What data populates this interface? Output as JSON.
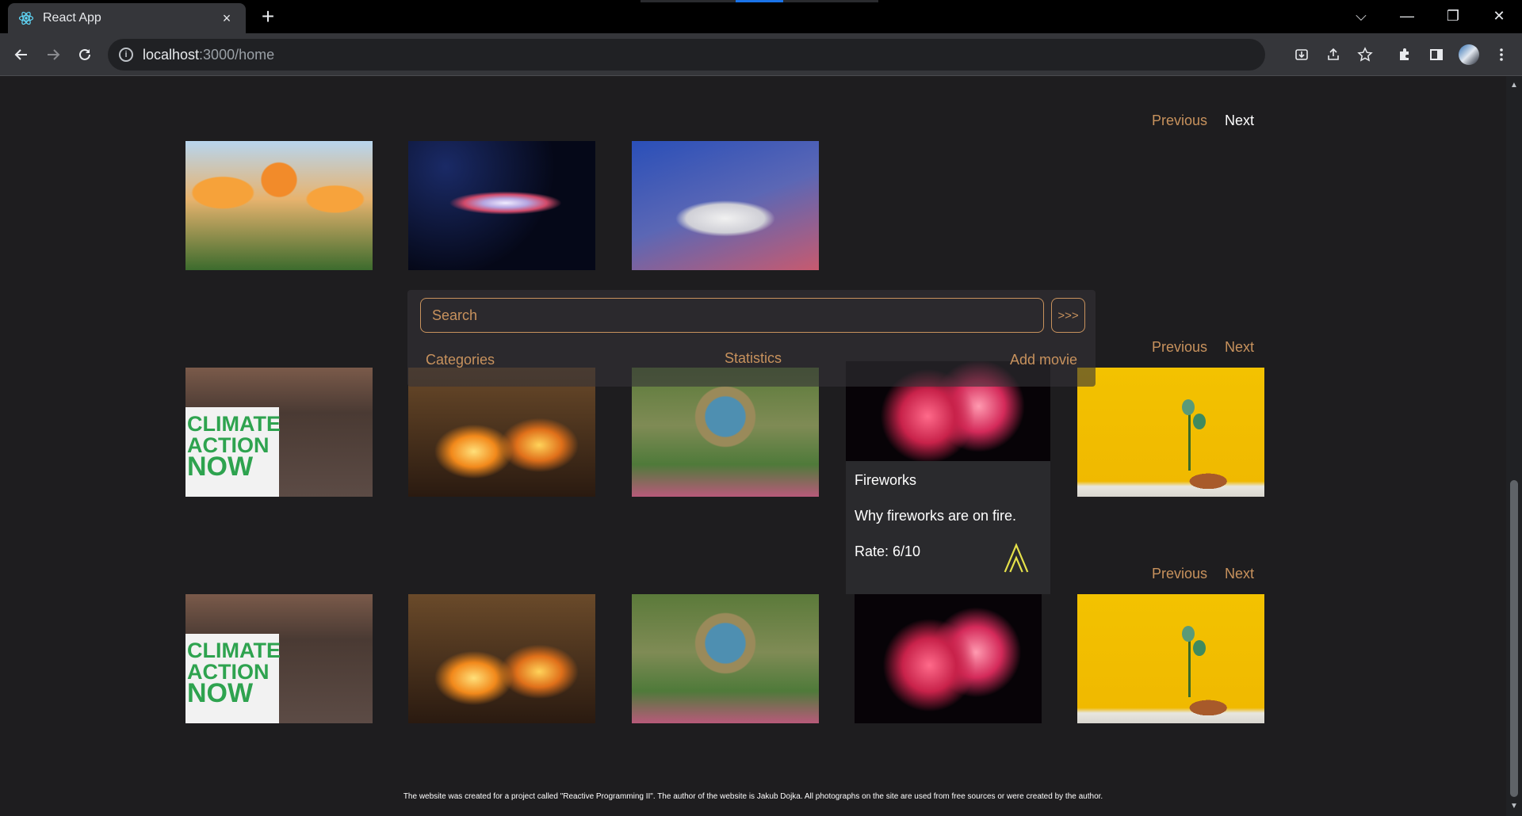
{
  "browser": {
    "tab_title": "React App",
    "tab_close": "×",
    "new_tab": "+",
    "url_host": "localhost",
    "url_path": ":3000/home",
    "window_controls": [
      "⌵",
      "—",
      "❐",
      "✕"
    ],
    "icons": [
      "install-icon",
      "share-icon",
      "star-icon",
      "extensions-icon",
      "sidepanel-icon",
      "profile-avatar",
      "menu-icon"
    ]
  },
  "pagers": [
    {
      "previous": "Previous",
      "next": "Next"
    },
    {
      "previous": "Previous",
      "next": "Next"
    },
    {
      "previous": "Previous",
      "next": "Next"
    }
  ],
  "search": {
    "placeholder": "Search",
    "go_label": ">>>",
    "links": {
      "categories": "Categories",
      "statistics": "Statistics",
      "add_movie": "Add movie"
    }
  },
  "card": {
    "title": "Fireworks",
    "description": "Why fireworks are on fire.",
    "rate": "Rate: 6/10"
  },
  "climate_sign": [
    "CLIMATE",
    "ACTION",
    "NOW"
  ],
  "footer": "The website was created for a project called \"Reactive Programming II\". The author of the website is Jakub Dojka. All photographs on the site are used from free sources or were created by the author.",
  "colors": {
    "accent": "#c8925d",
    "background": "#1e1d1f",
    "card": "#2a2a2d",
    "rate_arrow": "#e5e14a"
  }
}
